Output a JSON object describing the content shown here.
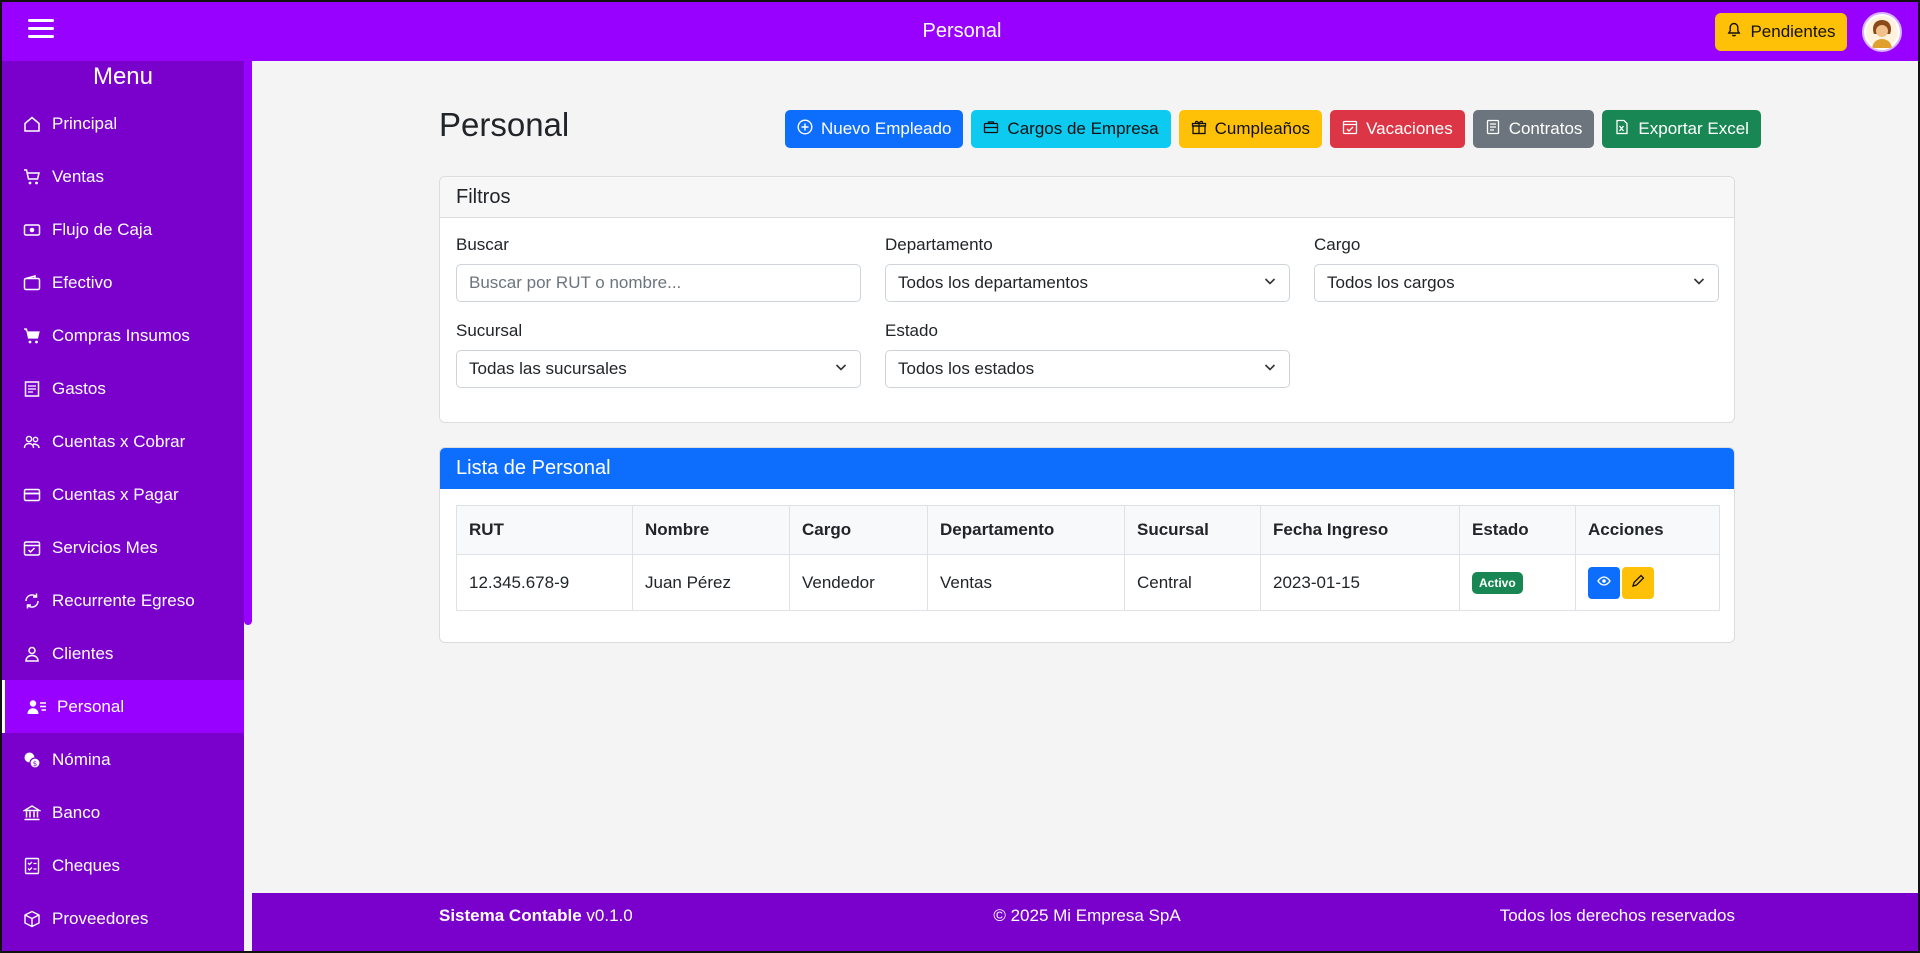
{
  "topbar": {
    "title": "Personal",
    "pendientes_label": "Pendientes"
  },
  "sidebar": {
    "menu_title": "Menu",
    "items": [
      {
        "label": "Principal",
        "icon": "home-icon"
      },
      {
        "label": "Ventas",
        "icon": "cart-icon"
      },
      {
        "label": "Flujo de Caja",
        "icon": "cash-icon"
      },
      {
        "label": "Efectivo",
        "icon": "wallet-icon"
      },
      {
        "label": "Compras Insumos",
        "icon": "cart-plus-icon"
      },
      {
        "label": "Gastos",
        "icon": "receipt-icon"
      },
      {
        "label": "Cuentas x Cobrar",
        "icon": "people-icon"
      },
      {
        "label": "Cuentas x Pagar",
        "icon": "credit-card-icon"
      },
      {
        "label": "Servicios Mes",
        "icon": "calendar-check-icon"
      },
      {
        "label": "Recurrente Egreso",
        "icon": "refresh-icon"
      },
      {
        "label": "Clientes",
        "icon": "person-icon"
      },
      {
        "label": "Personal",
        "icon": "person-lines-icon",
        "active": true
      },
      {
        "label": "Nómina",
        "icon": "coins-icon"
      },
      {
        "label": "Banco",
        "icon": "bank-icon"
      },
      {
        "label": "Cheques",
        "icon": "check-list-icon"
      },
      {
        "label": "Proveedores",
        "icon": "box-icon"
      }
    ]
  },
  "main": {
    "page_title": "Personal",
    "buttons": {
      "nuevo_empleado": "Nuevo Empleado",
      "cargos_empresa": "Cargos de Empresa",
      "cumpleanos": "Cumpleaños",
      "vacaciones": "Vacaciones",
      "contratos": "Contratos",
      "exportar_excel": "Exportar Excel"
    },
    "filters": {
      "header": "Filtros",
      "buscar_label": "Buscar",
      "buscar_placeholder": "Buscar por RUT o nombre...",
      "departamento_label": "Departamento",
      "departamento_value": "Todos los departamentos",
      "cargo_label": "Cargo",
      "cargo_value": "Todos los cargos",
      "sucursal_label": "Sucursal",
      "sucursal_value": "Todas las sucursales",
      "estado_label": "Estado",
      "estado_value": "Todos los estados"
    },
    "list": {
      "header": "Lista de Personal",
      "columns": [
        "RUT",
        "Nombre",
        "Cargo",
        "Departamento",
        "Sucursal",
        "Fecha Ingreso",
        "Estado",
        "Acciones"
      ],
      "rows": [
        {
          "rut": "12.345.678-9",
          "nombre": "Juan Pérez",
          "cargo": "Vendedor",
          "departamento": "Ventas",
          "sucursal": "Central",
          "fecha_ingreso": "2023-01-15",
          "estado": "Activo"
        }
      ]
    }
  },
  "footer": {
    "app_name": "Sistema Contable",
    "version": "v0.1.0",
    "copyright": "© 2025 Mi Empresa SpA",
    "rights": "Todos los derechos reservados"
  },
  "colors": {
    "topbar": "#9800ff",
    "sidebar": "#7a00cc",
    "primary": "#0d6efd",
    "warning": "#ffc107",
    "success": "#198754"
  }
}
